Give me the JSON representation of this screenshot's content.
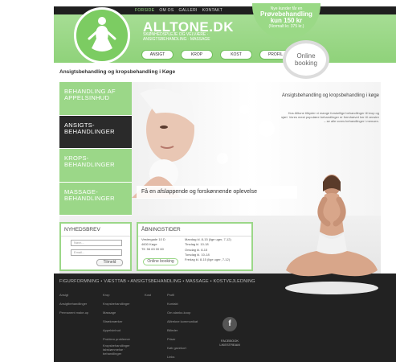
{
  "topnav": [
    "FORSIDE",
    "OM OS",
    "GALLERI",
    "KONTAKT"
  ],
  "brand": {
    "name": "ALLTONE.DK",
    "tagline": "SKØNHEDSPLEJE OG VELVÆRE · ANSIGTSBEHANDLING · MASSAGE"
  },
  "promo": {
    "line1": "Nye kunder får en",
    "line2": "Prøvebehandling",
    "line3": "kun 150 kr",
    "line4": "(Normalt kr. 375 kr.)"
  },
  "booking": {
    "line1": "Online",
    "line2": "booking"
  },
  "navbuttons": [
    "ANSIGT",
    "KROP",
    "KOST",
    "PROFIL"
  ],
  "page_title": "Ansigtsbehandling og kropsbehandling i Køge",
  "side_menu": [
    "BEHANDLING AF APPELSINHUD",
    "ANSIGTS-BEHANDLINGER",
    "KROPS-BEHANDLINGER",
    "MASSAGE-BEHANDLINGER"
  ],
  "hero": {
    "title": "Ansigtsbehandling og kropsbehandling i køge",
    "body": "Hos Alltone tilbyder vi mange forskellige behandlinger til krop og sjæl. Vores mest populære behandlinger er fremhævet her til venstre – se alle vores behandlinger i menuen.",
    "quote": "Få en afslappende og forskønnende oplevelse"
  },
  "newsletter": {
    "title": "NYHEDSBREV",
    "name_placeholder": "Navn...",
    "email_placeholder": "Email...",
    "button": "Tilmeld"
  },
  "hours": {
    "title": "ÅBNINGSTIDER",
    "address": [
      "Vestergade 10 D",
      "4600 Køge",
      "Tlf. 56 63 00 60"
    ],
    "rows": [
      "Mandag  kl.  8-15 (lige uger, 7-12)",
      "Tirsdag  kl.  10-18",
      "Onsdag  kl.  8-15",
      "Torsdag  kl.  10-18",
      "Fredag   kl.  8-15 (lige uger, 7-12)"
    ],
    "button": "Online booking"
  },
  "footer": {
    "nav": "FIGURFORMNING  •  VÆSTTAB  •  ANSIGTSBEHANDLING  •  MASSAGE  •  KOSTVEJLEDNING",
    "col1": [
      "Ansigt",
      "Ansigtbehandlinger",
      "Permanent make-up"
    ],
    "col2": [
      "Krop",
      "Kropsbehandlinger",
      "Massage",
      "Strækmærker",
      "Appelsinhud",
      "Problem problemer",
      "Kropsbehandlinger tabstømmelse · behandlinger"
    ],
    "col3": [
      "Kost"
    ],
    "col4": [
      "Profil",
      "Kontakt",
      "Om alanko-koop",
      "Alltrekne kommunikat",
      "Billeder",
      "Priser",
      "Køb gavekort",
      "Links"
    ],
    "facebook": "FACEBOOK",
    "facebook2": "LIKESTREAM"
  },
  "colors": {
    "green": "#9bd788",
    "dark": "#222222"
  }
}
